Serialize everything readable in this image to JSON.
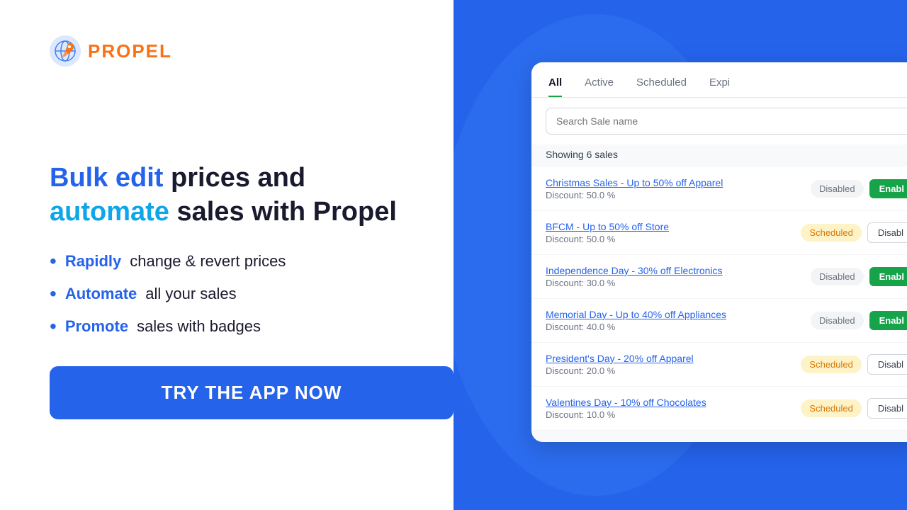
{
  "logo": {
    "text": "PROPEL"
  },
  "headline": {
    "part1_highlight": "Bulk edit",
    "part1_rest": " prices and",
    "part2_highlight": "automate",
    "part2_rest": " sales with Propel"
  },
  "bullets": [
    {
      "highlight": "Rapidly",
      "rest": " change & revert prices"
    },
    {
      "highlight": "Automate",
      "rest": " all your sales"
    },
    {
      "highlight": "Promote",
      "rest": " sales with badges"
    }
  ],
  "cta": {
    "label": "TRY THE APP NOW"
  },
  "app": {
    "tabs": [
      {
        "label": "All",
        "active": true
      },
      {
        "label": "Active"
      },
      {
        "label": "Scheduled"
      },
      {
        "label": "Expi"
      }
    ],
    "search_placeholder": "Search Sale name",
    "showing_label": "Showing 6 sales",
    "sales": [
      {
        "name": "Christmas Sales - Up to 50% off Apparel",
        "discount": "Discount: 50.0 %",
        "status": "Disabled",
        "status_type": "disabled",
        "action": "Enabl",
        "action_type": "enable"
      },
      {
        "name": "BFCM - Up to 50% off Store",
        "discount": "Discount: 50.0 %",
        "status": "Scheduled",
        "status_type": "scheduled",
        "action": "Disabl",
        "action_type": "disable"
      },
      {
        "name": "Independence Day - 30% off Electronics",
        "discount": "Discount: 30.0 %",
        "status": "Disabled",
        "status_type": "disabled",
        "action": "Enabl",
        "action_type": "enable"
      },
      {
        "name": "Memorial Day - Up to 40% off Appliances",
        "discount": "Discount: 40.0 %",
        "status": "Disabled",
        "status_type": "disabled",
        "action": "Enabl",
        "action_type": "enable"
      },
      {
        "name": "President's Day - 20% off Apparel",
        "discount": "Discount: 20.0 %",
        "status": "Scheduled",
        "status_type": "scheduled",
        "action": "Disabl",
        "action_type": "disable"
      },
      {
        "name": "Valentines Day - 10% off Chocolates",
        "discount": "Discount: 10.0 %",
        "status": "Scheduled",
        "status_type": "scheduled",
        "action": "Disabl",
        "action_type": "disable"
      }
    ]
  }
}
